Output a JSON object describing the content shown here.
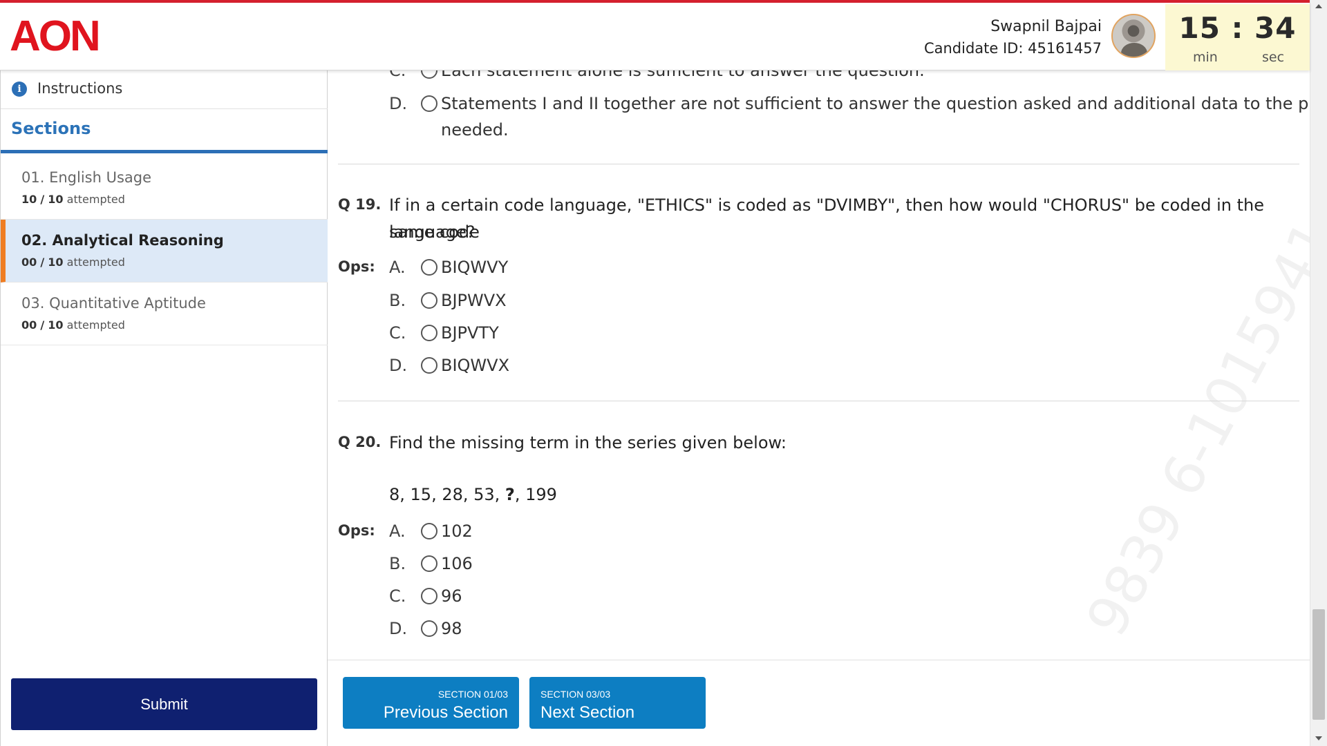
{
  "brand": {
    "logo_text": "AON",
    "accent_color": "#d5202e"
  },
  "candidate": {
    "name": "Swapnil Bajpai",
    "id_label": "Candidate ID: 45161457"
  },
  "timer": {
    "display": "15 : 34",
    "min_label": "min",
    "sec_label": "sec"
  },
  "sidebar": {
    "instructions_label": "Instructions",
    "sections_heading": "Sections",
    "sections": [
      {
        "title": "01. English Usage",
        "done": "10",
        "total": "10",
        "suffix": "attempted"
      },
      {
        "title": "02. Analytical Reasoning",
        "done": "00",
        "total": "10",
        "suffix": "attempted"
      },
      {
        "title": "03. Quantitative Aptitude",
        "done": "00",
        "total": "10",
        "suffix": "attempted"
      }
    ],
    "submit_label": "Submit"
  },
  "prev_question": {
    "options": [
      {
        "letter": "C.",
        "text": "Each statement alone is sufficient to answer the question."
      },
      {
        "letter": "D.",
        "text": "Statements I and II together are not sufficient to answer the question asked and additional data to the problem is",
        "text_line2": "needed."
      }
    ]
  },
  "questions": [
    {
      "number": "Q 19.",
      "text_line1": "If in a certain code language, \"ETHICS\" is coded as \"DVIMBY\", then how would \"CHORUS\" be coded in the same code",
      "text_line2": "language?",
      "ops_label": "Ops:",
      "options": [
        {
          "letter": "A.",
          "text": "BIQWVY"
        },
        {
          "letter": "B.",
          "text": "BJPWVX"
        },
        {
          "letter": "C.",
          "text": "BJPVTY"
        },
        {
          "letter": "D.",
          "text": "BIQWVX"
        }
      ]
    },
    {
      "number": "Q 20.",
      "text_line1": "Find the missing term in the series given below:",
      "series_before": "8, 15, 28, 53, ",
      "series_mark": "?",
      "series_after": ", 199",
      "ops_label": "Ops:",
      "options": [
        {
          "letter": "A.",
          "text": "102"
        },
        {
          "letter": "B.",
          "text": "106"
        },
        {
          "letter": "C.",
          "text": "96"
        },
        {
          "letter": "D.",
          "text": "98"
        }
      ]
    }
  ],
  "watermark": "9839 6-1015941",
  "nav": {
    "prev": {
      "small": "SECTION 01/03",
      "big": "Previous Section"
    },
    "next": {
      "small": "SECTION 03/03",
      "big": "Next Section"
    }
  }
}
